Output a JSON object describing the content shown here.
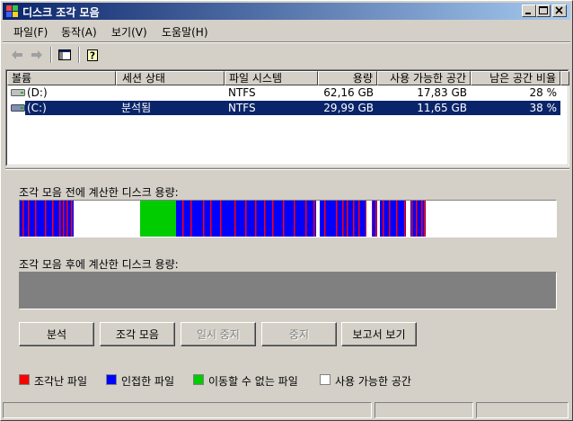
{
  "window": {
    "title": "디스크 조각 모음"
  },
  "menu": [
    "파일(F)",
    "동작(A)",
    "보기(V)",
    "도움말(H)"
  ],
  "toolbar": {
    "back_icon": "back-arrow-icon",
    "forward_icon": "forward-arrow-icon",
    "console_icon": "console-tree-icon",
    "help_icon": "help-icon"
  },
  "list": {
    "columns": [
      "볼륨",
      "세션 상태",
      "파일 시스템",
      "용량",
      "사용 가능한 공간",
      "남은 공간 비율"
    ],
    "rows": [
      {
        "volume": "(D:)",
        "status": "",
        "fs": "NTFS",
        "capacity": "62,16 GB",
        "free": "17,83 GB",
        "percent": "28 %"
      },
      {
        "volume": "(C:)",
        "status": "분석됨",
        "fs": "NTFS",
        "capacity": "29,99 GB",
        "free": "11,65 GB",
        "percent": "38 %"
      }
    ]
  },
  "labels": {
    "before": "조각 모음 전에 계산한 디스크 용량:",
    "after": "조각 모음 후에 계산한 디스크 용량:"
  },
  "buttons": {
    "analyze": "분석",
    "defrag": "조각 모음",
    "pause": "일시 중지",
    "stop": "중지",
    "report": "보고서 보기"
  },
  "legend": {
    "fragmented": "조각난 파일",
    "contiguous": "인접한 파일",
    "unmovable": "이동할 수 없는 파일",
    "free": "사용 가능한 공간"
  },
  "colors": {
    "fragmented": "#ff0000",
    "contiguous": "#0000ff",
    "unmovable": "#00cc00",
    "free": "#ffffff",
    "selection": "#0a246a"
  }
}
